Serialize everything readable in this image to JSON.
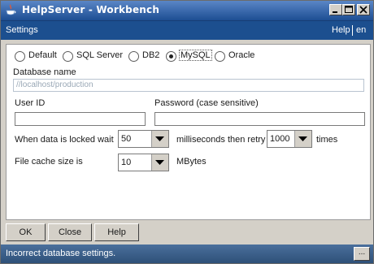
{
  "window": {
    "title": "HelpServer - Workbench",
    "icon": "java-cup-icon"
  },
  "menubar": {
    "title": "Settings",
    "help_link": "Help",
    "lang_link": "en"
  },
  "db_types": {
    "options": [
      "Default",
      "SQL Server",
      "DB2",
      "MySQL",
      "Oracle"
    ],
    "selected": "MySQL"
  },
  "database": {
    "label": "Database name",
    "value": "//localhost/production"
  },
  "user": {
    "label": "User ID",
    "value": ""
  },
  "password": {
    "label": "Password (case sensitive)",
    "value": ""
  },
  "lock": {
    "prefix": "When data is locked wait",
    "wait_value": "50",
    "middle": "milliseconds then retry",
    "retry_value": "1000",
    "suffix": "times"
  },
  "cache": {
    "label": "File cache size is",
    "value": "10",
    "unit": "MBytes"
  },
  "buttons": {
    "ok": "OK",
    "close": "Close",
    "help": "Help"
  },
  "status": {
    "message": "Incorrect database settings.",
    "more": "..."
  },
  "colors": {
    "title_bar": "#1d4e93",
    "menu_bar": "#1c4f8f",
    "status_bar": "#2e5078",
    "panel": "#d4d0c8"
  }
}
